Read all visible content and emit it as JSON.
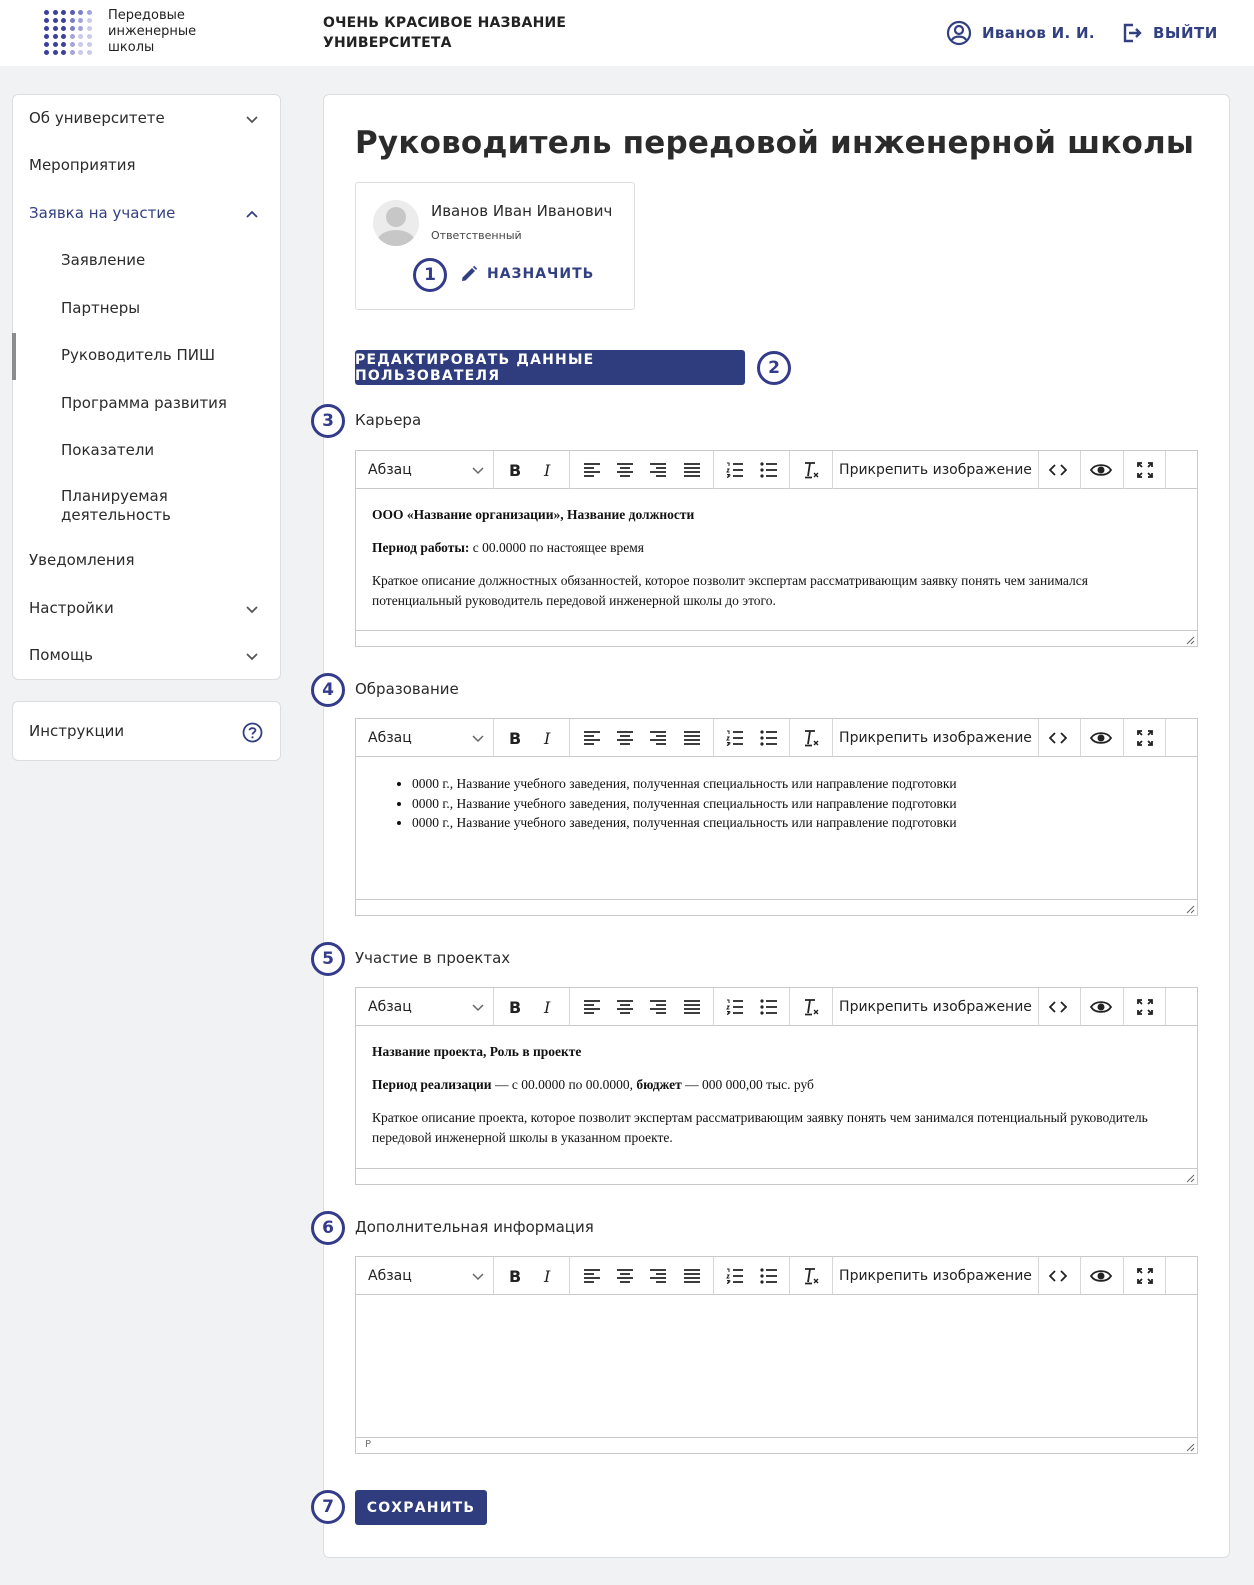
{
  "header": {
    "logo_text": "Передовые инженерные школы",
    "university_name": "ОЧЕНЬ КРАСИВОЕ НАЗВАНИЕ УНИВЕРСИТЕТА",
    "user_name": "Иванов И. И.",
    "logout_label": "ВЫЙТИ",
    "user_icon": "user-circle-icon",
    "logout_icon": "logout-icon"
  },
  "sidebar": {
    "items": [
      {
        "label": "Об университете",
        "chevron": "down"
      },
      {
        "label": "Мероприятия"
      },
      {
        "label": "Заявка на участие",
        "chevron": "up",
        "active": true
      },
      {
        "label": "Заявление"
      },
      {
        "label": "Партнеры"
      },
      {
        "label": "Руководитель ПИШ",
        "selected": true
      },
      {
        "label": "Программа развития"
      },
      {
        "label": "Показатели"
      },
      {
        "label": "Планируемая деятельность"
      },
      {
        "label": "Уведомления"
      },
      {
        "label": "Настройки",
        "chevron": "down"
      },
      {
        "label": "Помощь",
        "chevron": "down"
      }
    ],
    "instructions_label": "Инструкции",
    "instructions_icon": "help-circle-icon"
  },
  "main": {
    "title": "Руководитель передовой инженерной школы",
    "person": {
      "name": "Иванов Иван Иванович",
      "role": "Ответственный",
      "assign_label": "НАЗНАЧИТЬ"
    },
    "edit_user_label": "РЕДАКТИРОВАТЬ ДАННЫЕ ПОЛЬЗОВАТЕЛЯ",
    "save_label": "СОХРАНИТЬ",
    "callouts": [
      "1",
      "2",
      "3",
      "4",
      "5",
      "6",
      "7"
    ],
    "toolbar": {
      "format_select": "Абзац",
      "attach_image": "Прикрепить изображение",
      "buttons": [
        "bold",
        "italic",
        "align-left",
        "align-center",
        "align-right",
        "align-justify",
        "ordered-list",
        "bullet-list",
        "clear-format",
        "code",
        "preview",
        "fullscreen"
      ]
    },
    "sections": {
      "career": {
        "label": "Карьера",
        "line1": "ООО «Название организации», Название должности",
        "line2_bold": "Период работы:",
        "line2_rest": " с 00.0000 по настоящее время",
        "line3": "Краткое описание должностных обязанностей, которое позволит экспертам рассматривающим заявку понять чем занимался потенциальный руководитель передовой инженерной школы до этого."
      },
      "education": {
        "label": "Образование",
        "items": [
          "0000 г., Название учебного заведения, полученная специальность или направление подготовки",
          "0000 г., Название учебного заведения, полученная специальность или направление подготовки",
          "0000 г., Название учебного заведения, полученная специальность или направление подготовки"
        ]
      },
      "projects": {
        "label": "Участие в проектах",
        "line1": "Название проекта, Роль в проекте",
        "line2_bold1": "Период реализации",
        "line2_mid": " — с 00.0000 по 00.0000, ",
        "line2_bold2": "бюджет",
        "line2_end": " — 000 000,00 тыс. руб",
        "line3": "Краткое описание проекта, которое позволит экспертам рассматривающим заявку понять чем занимался потенциальный руководитель передовой инженерной школы в указанном проекте."
      },
      "additional": {
        "label": "Дополнительная информация",
        "status_path": "P"
      }
    }
  },
  "colors": {
    "accent": "#2f3d7f",
    "callout": "#343b8a",
    "background": "#f1f2f4"
  }
}
